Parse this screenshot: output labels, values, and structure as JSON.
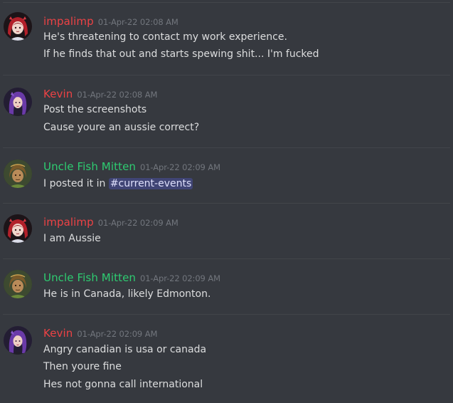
{
  "colors": {
    "background": "#36393f",
    "text": "#dcddde",
    "timestamp": "#72767d",
    "red_role": "#ed4245",
    "pink_role": "#ed4245",
    "green_role": "#2ecc71",
    "mention_bg": "#4b4f8c"
  },
  "messages": [
    {
      "username": "impalimp",
      "timestamp": "01-Apr-22 02:08 AM",
      "avatar_icon": "red-haired-avatar-icon",
      "lines": [
        "He's threatening to contact my work experience.",
        "If he finds that out and starts spewing shit... I'm fucked"
      ]
    },
    {
      "username": "Kevin",
      "timestamp": "01-Apr-22 02:08 AM",
      "avatar_icon": "purple-haired-avatar-icon",
      "lines": [
        "Post the screenshots",
        "Cause youre an aussie correct?"
      ]
    },
    {
      "username": "Uncle Fish Mitten",
      "timestamp": "01-Apr-22 02:09 AM",
      "avatar_icon": "green-portrait-avatar-icon",
      "line_prefix": "I posted it in",
      "mention": "#current-events"
    },
    {
      "username": "impalimp",
      "timestamp": "01-Apr-22 02:09 AM",
      "avatar_icon": "red-haired-avatar-icon",
      "lines": [
        "I am Aussie"
      ]
    },
    {
      "username": "Uncle Fish Mitten",
      "timestamp": "01-Apr-22 02:09 AM",
      "avatar_icon": "green-portrait-avatar-icon",
      "lines": [
        "He is in Canada, likely Edmonton."
      ]
    },
    {
      "username": "Kevin",
      "timestamp": "01-Apr-22 02:09 AM",
      "avatar_icon": "purple-haired-avatar-icon",
      "lines": [
        "Angry canadian is usa or canada",
        "Then youre fine",
        "Hes not gonna call international"
      ]
    }
  ]
}
